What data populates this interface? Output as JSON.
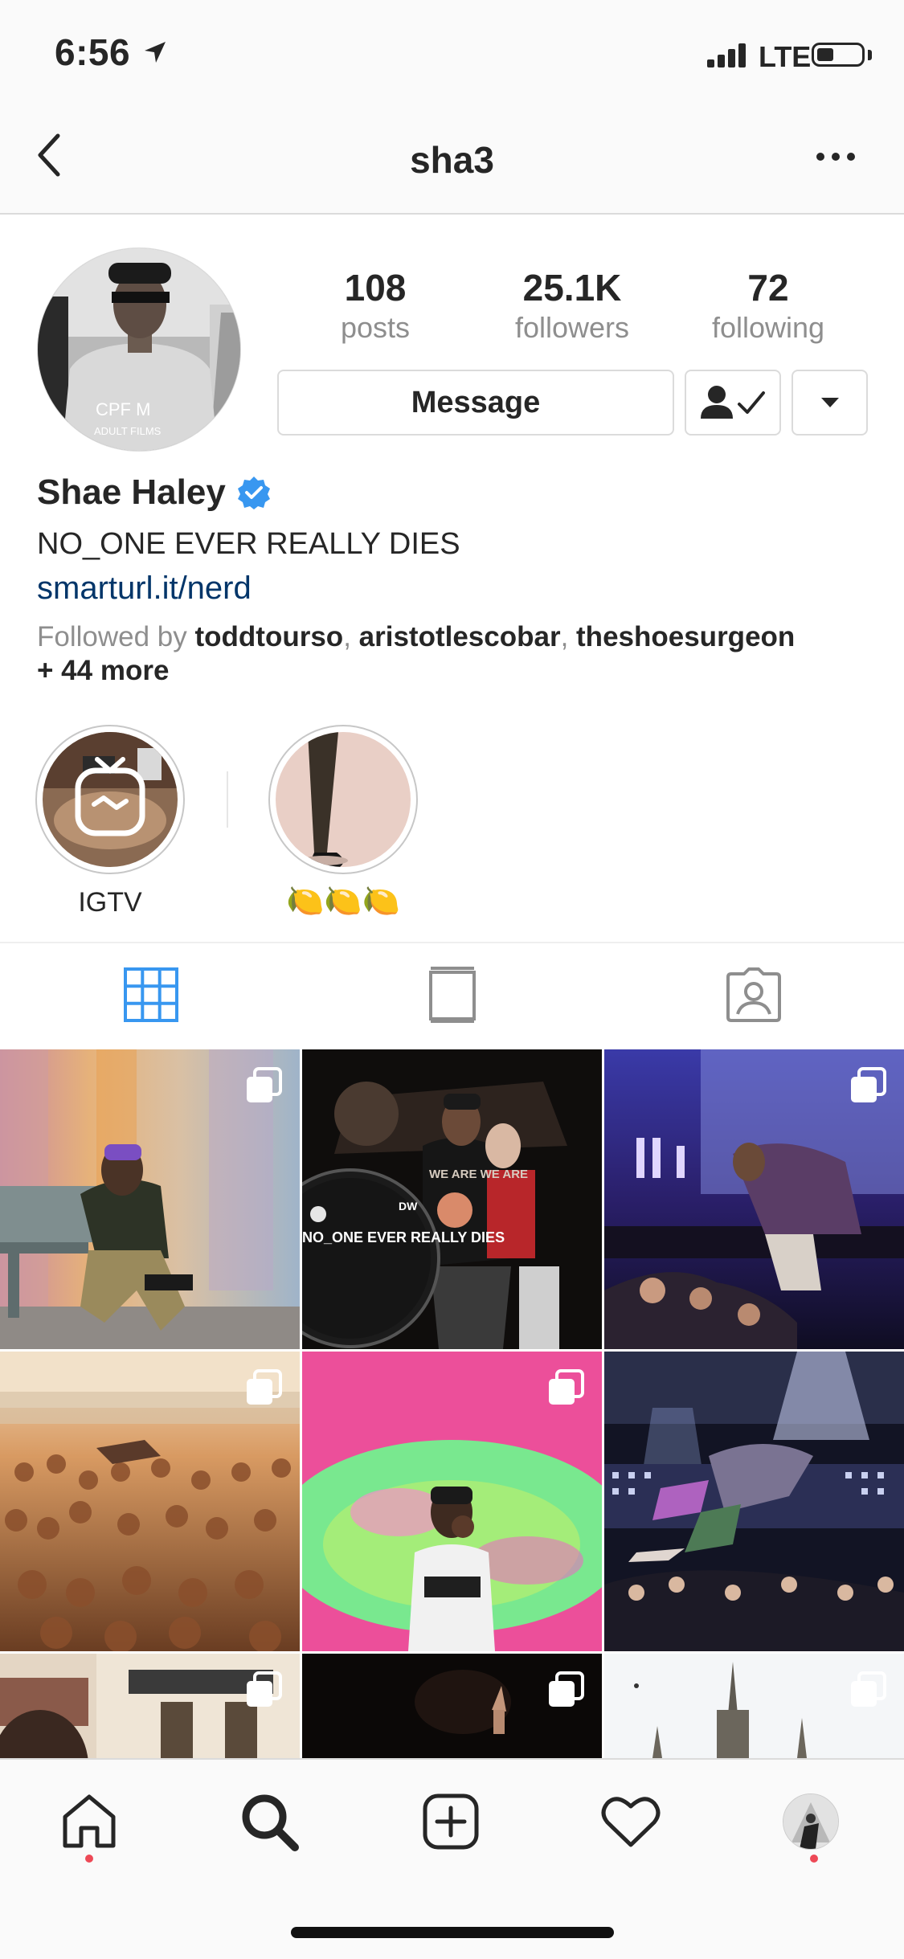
{
  "status_bar": {
    "time": "6:56",
    "network": "LTE"
  },
  "header": {
    "title": "sha3",
    "back_icon": "chevron-left-icon",
    "more_icon": "ellipsis-icon"
  },
  "profile": {
    "stats": [
      {
        "value": "108",
        "label": "posts"
      },
      {
        "value": "25.1K",
        "label": "followers"
      },
      {
        "value": "72",
        "label": "following"
      }
    ],
    "message_label": "Message",
    "display_name": "Shae Haley",
    "verified": true,
    "bio": "NO_ONE EVER REALLY DIES",
    "link": "smarturl.it/nerd",
    "followed_by": {
      "prefix": "Followed by",
      "users": [
        "toddtourso",
        "aristotlescobar",
        "theshoesurgeon"
      ],
      "more": "+ 44 more"
    },
    "avatar_text": {
      "line1": "CPF M",
      "line2": "ADULT FILMS"
    }
  },
  "highlights": [
    {
      "label": "IGTV"
    },
    {
      "label": "🍋🍋🍋"
    }
  ],
  "tabs": [
    "grid-icon",
    "igtv-tab-icon",
    "tagged-icon"
  ],
  "grid_tiles": [
    {
      "id": "post-1",
      "multi": true
    },
    {
      "id": "post-2",
      "multi": false,
      "shirt_text": "WE ARE WE ARE",
      "drum_text": "NO_ONE EVER REALLY DIES",
      "drum_brand": "DW"
    },
    {
      "id": "post-3",
      "multi": true
    },
    {
      "id": "post-4",
      "multi": true
    },
    {
      "id": "post-5",
      "multi": true
    },
    {
      "id": "post-6",
      "multi": false
    },
    {
      "id": "post-7",
      "multi": true
    },
    {
      "id": "post-8",
      "multi": true
    },
    {
      "id": "post-9",
      "multi": true
    }
  ],
  "bottom_nav": [
    "home-icon",
    "search-icon",
    "new-post-icon",
    "activity-heart-icon",
    "profile-avatar"
  ],
  "colors": {
    "link": "#003569",
    "verified": "#3897f0",
    "notification": "#ed4956",
    "active_tab": "#3897f0"
  }
}
